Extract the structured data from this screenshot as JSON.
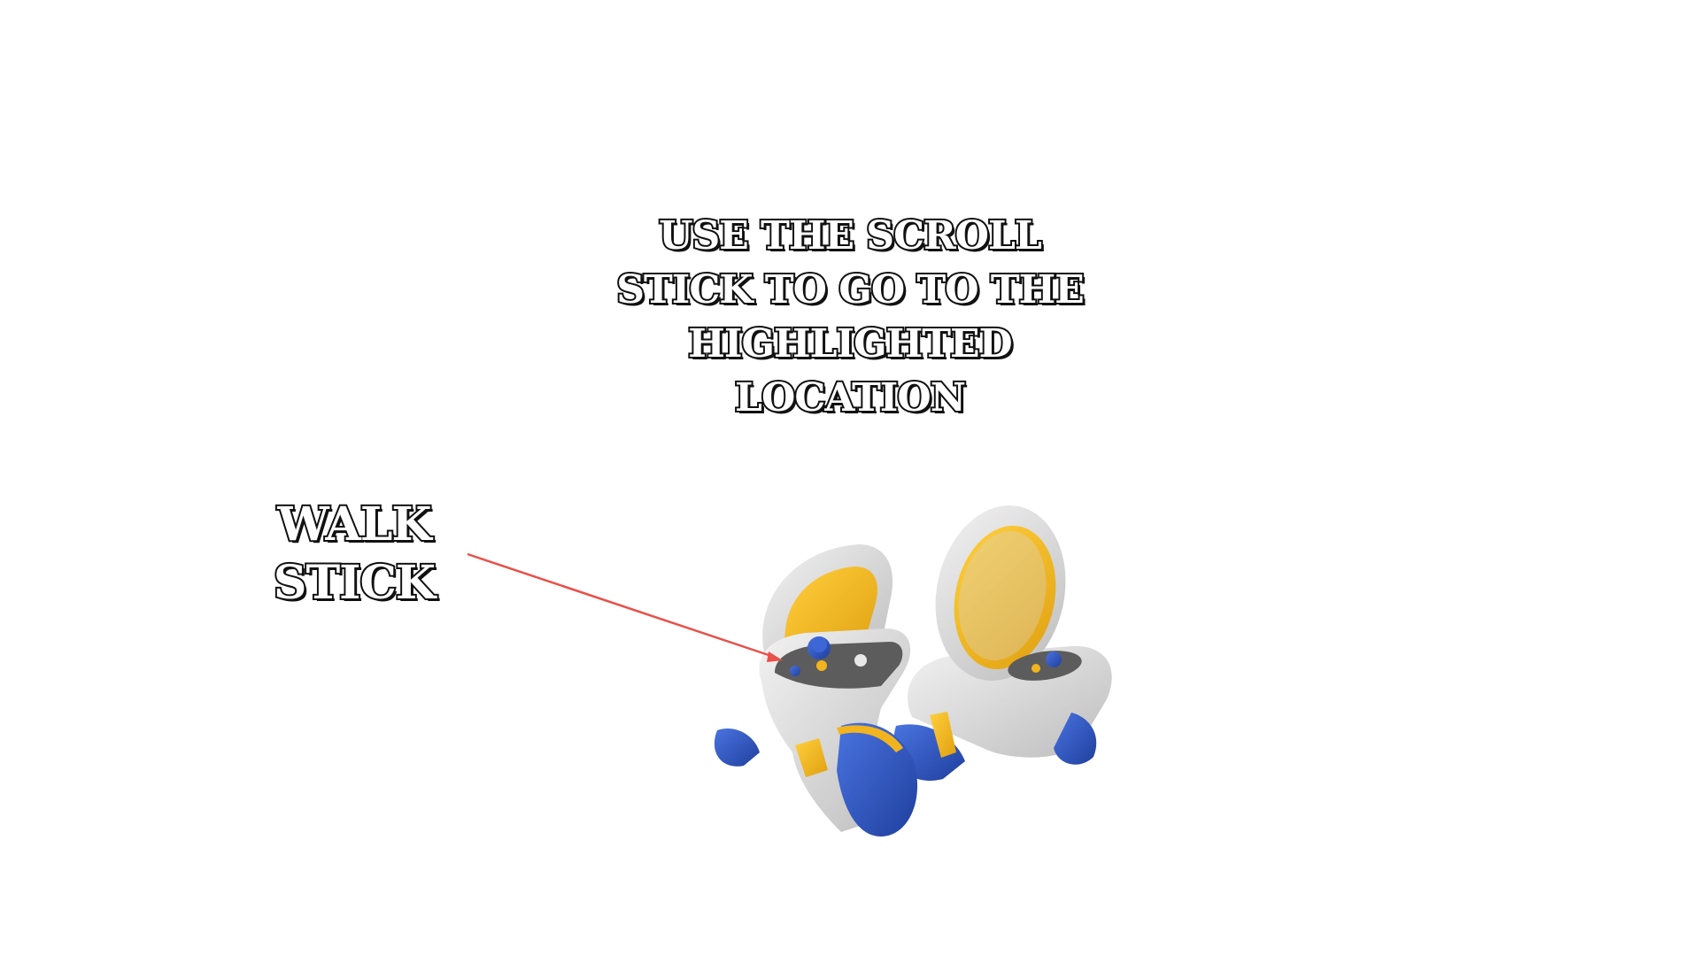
{
  "instruction": {
    "lines": [
      "USE THE SCROLL",
      "STICK TO GO TO THE",
      "HIGHLIGHTED",
      "LOCATION"
    ]
  },
  "walk_label": {
    "lines": [
      "WALK",
      "STICK"
    ]
  },
  "colors": {
    "background": "#ffffff",
    "controller_body": "#dcdcdc",
    "controller_accent": "#f2b41e",
    "controller_blue": "#2f58c4",
    "arrow": "#e8504a",
    "text_outline": "#111111"
  },
  "icons": {
    "left_controller": "vr-controller-left-icon",
    "right_controller": "vr-controller-right-icon",
    "pointer": "arrow-pointer-icon"
  }
}
